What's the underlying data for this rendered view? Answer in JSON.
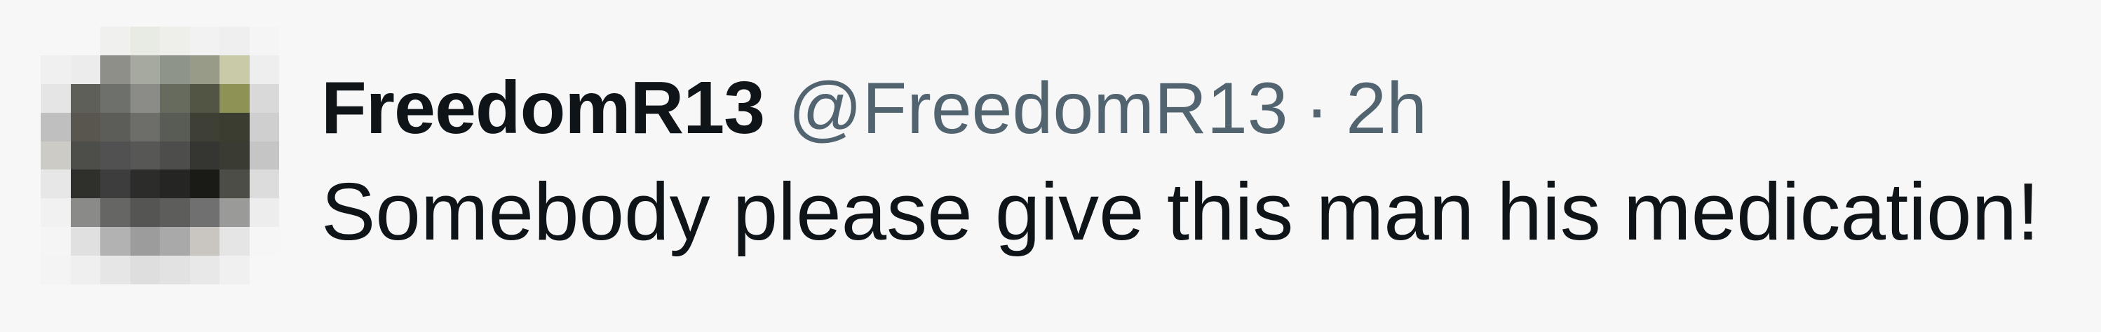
{
  "tweet": {
    "display_name": "FreedomR13",
    "handle": "@FreedomR13",
    "separator": "·",
    "timestamp": "2h",
    "text": "Somebody please give this man his medication!"
  },
  "avatar": {
    "icon": "pixelated-avatar-icon",
    "pixels": [
      "#f7f7f7",
      "#f7f7f7",
      "#f0f0ee",
      "#e8ebe4",
      "#eeeeea",
      "#f2f2f2",
      "#efefef",
      "#f5f5f5",
      "#f0f0f0",
      "#ececec",
      "#8d8f88",
      "#a6a99f",
      "#8e9489",
      "#979b87",
      "#c8caa8",
      "#eeeeee",
      "#e5e5e5",
      "#5e5f59",
      "#6e706b",
      "#8b8c88",
      "#676b5e",
      "#535544",
      "#8f9255",
      "#d9d9d9",
      "#bfbfbf",
      "#58564f",
      "#5c5d58",
      "#6d6e69",
      "#595c55",
      "#3e4036",
      "#3b3d30",
      "#cfcfcf",
      "#cdcbc6",
      "#4d4d49",
      "#505150",
      "#575856",
      "#4d4e4b",
      "#353631",
      "#3a3b33",
      "#c5c5c5",
      "#e7e7e7",
      "#2f302c",
      "#3c3d3c",
      "#2c2d2b",
      "#252623",
      "#1a1a17",
      "#4c4d47",
      "#dcdcdc",
      "#f1f1f1",
      "#8a8a88",
      "#666665",
      "#555554",
      "#5d5d5c",
      "#707070",
      "#9a9a99",
      "#ededed",
      "#f5f5f5",
      "#e0e0e0",
      "#b2b2b2",
      "#9c9c9c",
      "#a9a9a9",
      "#c9c6c2",
      "#e5e5e5",
      "#f6f6f6",
      "#f4f4f4",
      "#efefef",
      "#e6e6e6",
      "#dedede",
      "#e2e2e2",
      "#e8e8e8",
      "#f0f0f0",
      "#f7f7f7"
    ]
  }
}
